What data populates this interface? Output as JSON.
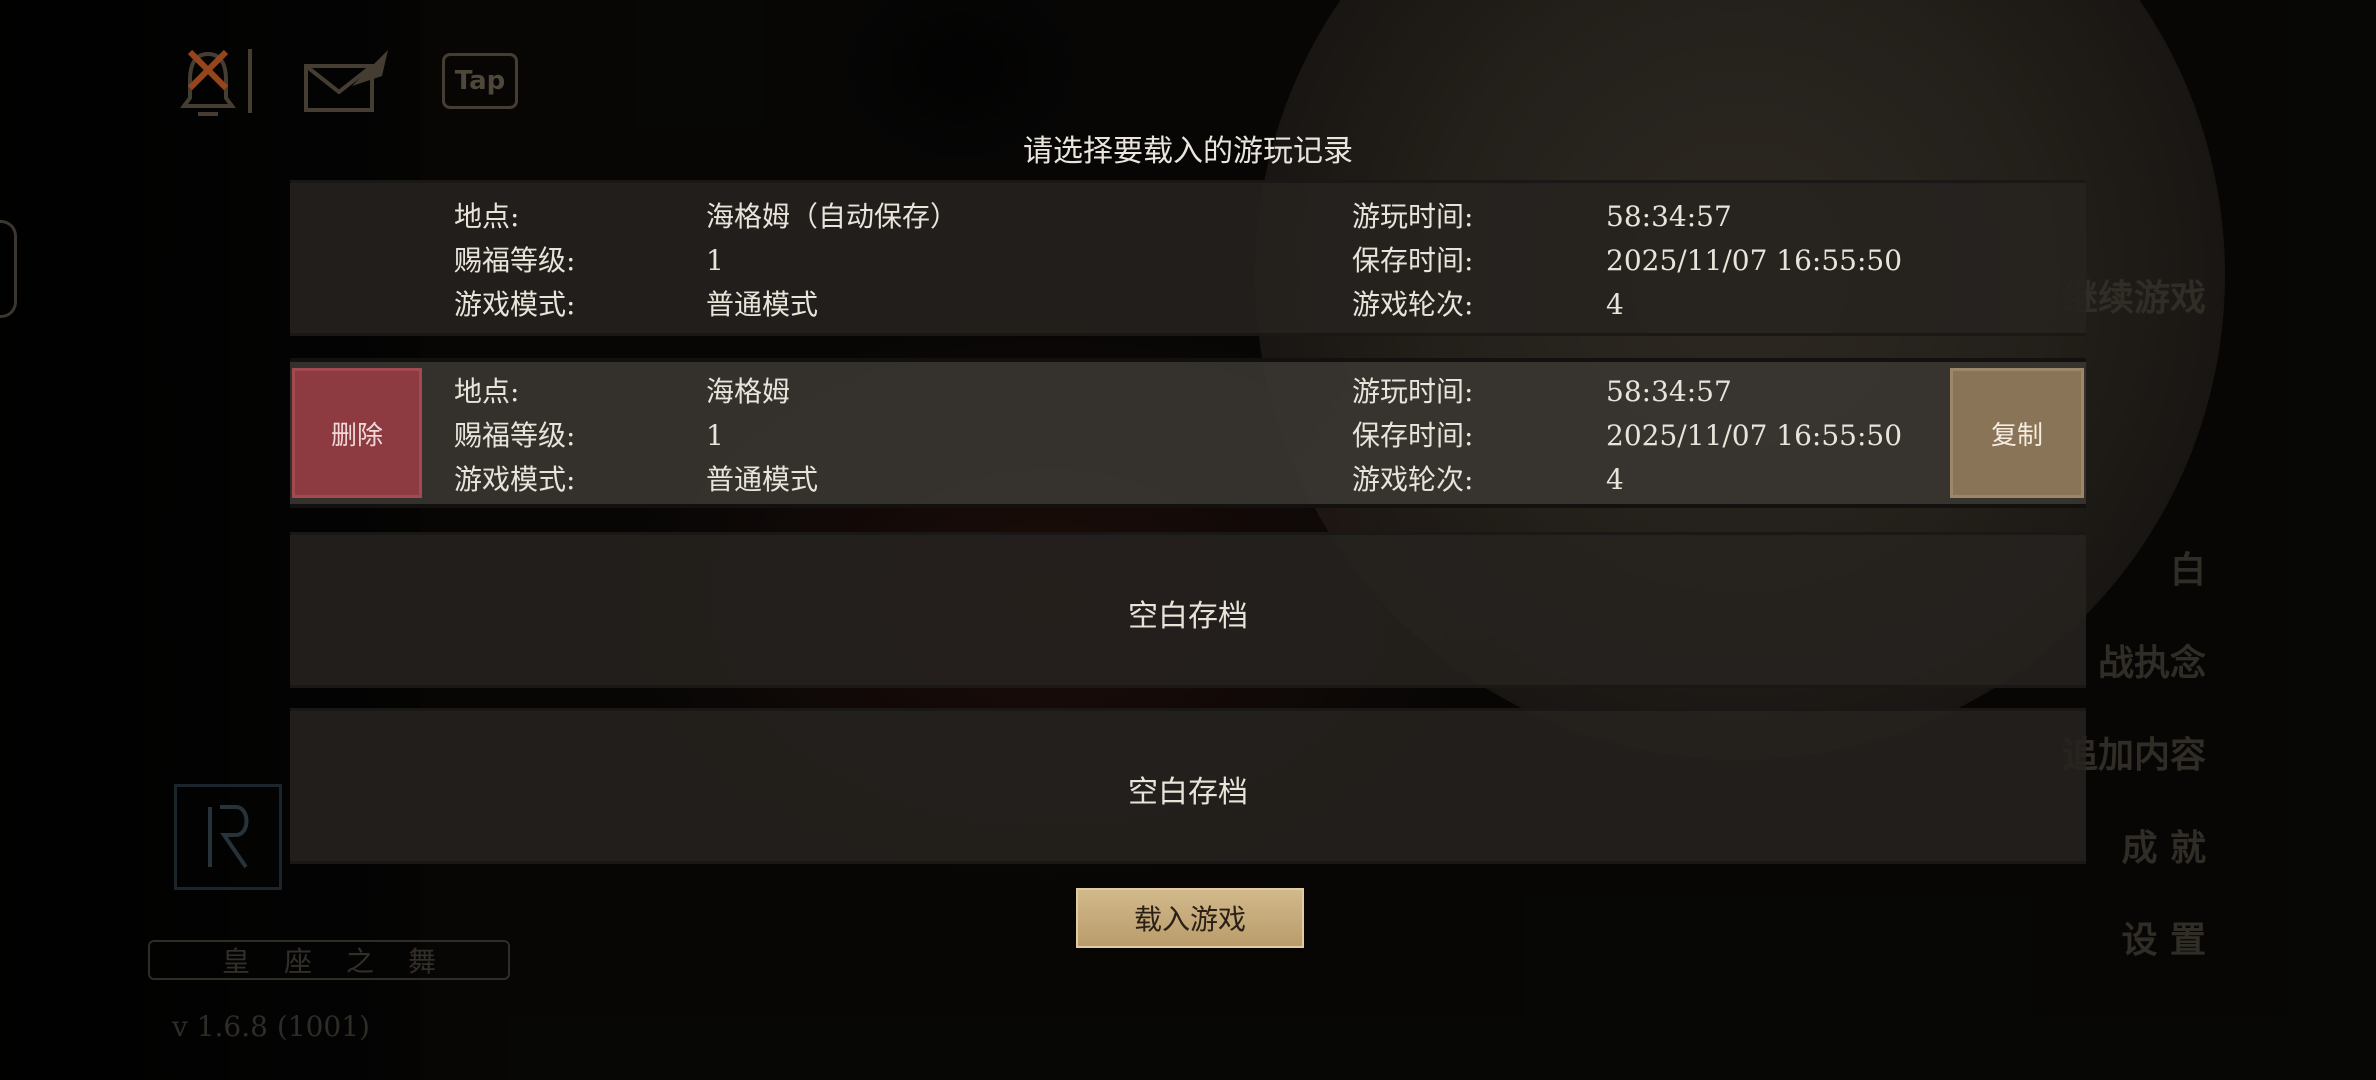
{
  "prompt": "请选择要载入的游玩记录",
  "top_icons": [
    "bell-icon",
    "mail-icon",
    "tap-icon"
  ],
  "tap_label": "Tap",
  "slots": [
    {
      "location_label": "地点:",
      "location": "海格姆（自动保存）",
      "level_label": "赐福等级:",
      "level": "1",
      "mode_label": "游戏模式:",
      "mode": "普通模式",
      "playtime_label": "游玩时间:",
      "playtime": "58:34:57",
      "savetime_label": "保存时间:",
      "savetime": "2025/11/07 16:55:50",
      "round_label": "游戏轮次:",
      "round": "4"
    },
    {
      "location_label": "地点:",
      "location": "海格姆",
      "level_label": "赐福等级:",
      "level": "1",
      "mode_label": "游戏模式:",
      "mode": "普通模式",
      "playtime_label": "游玩时间:",
      "playtime": "58:34:57",
      "savetime_label": "保存时间:",
      "savetime": "2025/11/07 16:55:50",
      "round_label": "游戏轮次:",
      "round": "4"
    }
  ],
  "delete_label": "删除",
  "copy_label": "复制",
  "empty_slots": [
    "空白存档",
    "空白存档"
  ],
  "load_button": "载入游戏",
  "right_menu": [
    "继续游戏",
    "白",
    "战执念",
    "追加内容",
    "成 就",
    "设 置"
  ],
  "game_title": "皇座之舞",
  "version": "v 1.6.8 (1001)"
}
